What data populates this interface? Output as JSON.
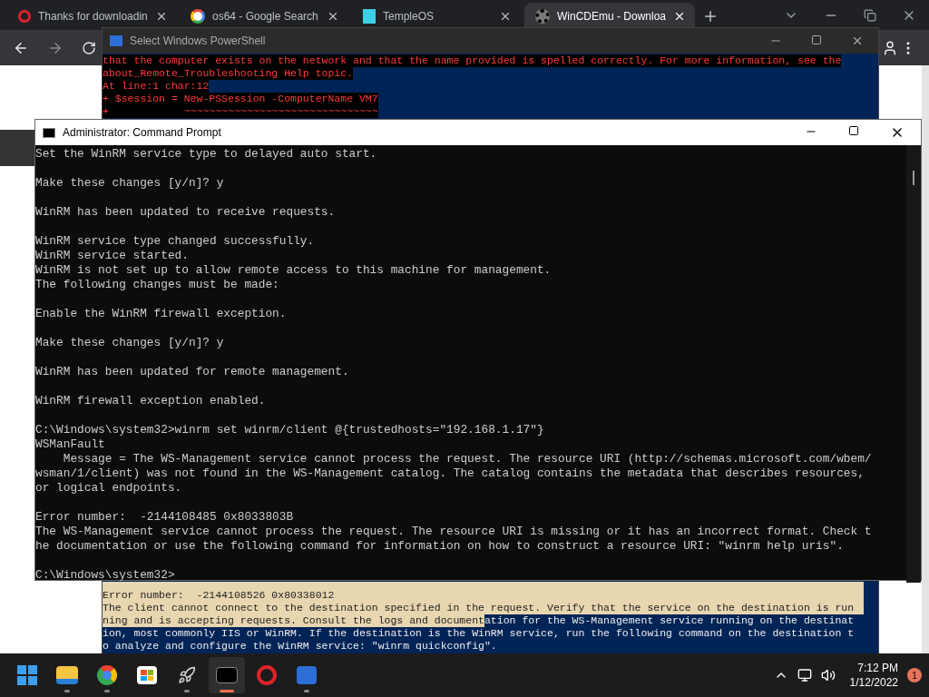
{
  "browser": {
    "tabs": [
      {
        "title": "Thanks for downloadin",
        "kind": "opera",
        "selected": false
      },
      {
        "title": "os64 - Google Search",
        "kind": "google",
        "selected": false
      },
      {
        "title": "TempleOS",
        "kind": "temple",
        "selected": false
      },
      {
        "title": "WinCDEmu - Downloa",
        "kind": "gear",
        "selected": true
      }
    ]
  },
  "powershell": {
    "title": "Select Windows PowerShell",
    "top_lines": [
      "that the computer exists on the network and that the name provided is spelled correctly. For more information, see the",
      "about_Remote_Troubleshooting Help topic.",
      "At line:1 char:12",
      "+ $session = New-PSSession -ComputerName VM7",
      "+            ~~~~~~~~~~~~~~~~~~~~~~~~~~~~~~~"
    ],
    "bottom_lines": [
      [
        {
          "text": "Error number:  -2144108526 0x80338012",
          "selected": true
        }
      ],
      [
        {
          "text": "The client cannot connect to the destination specified in the request. Verify that the service on the destination is run",
          "selected": true
        }
      ],
      [
        {
          "text": "ning and is accepting requests. Consult the logs and document",
          "selected": true
        },
        {
          "text": "ation for the WS-Management service running on the destinat",
          "selected": false
        }
      ],
      [
        {
          "text": "ion, most commonly IIS or WinRM. If the destination is the WinRM service, run the following command on the destination t",
          "selected": false
        }
      ],
      [
        {
          "text": "o analyze and configure the WinRM service: \"winrm quickconfig\".",
          "selected": false
        }
      ]
    ]
  },
  "cmd": {
    "title": "Administrator: Command Prompt",
    "blocks": [
      [
        "Set the WinRM service type to delayed auto start."
      ],
      [
        "Make these changes [y/n]? y"
      ],
      [
        "WinRM has been updated to receive requests."
      ],
      [
        "WinRM service type changed successfully.",
        "WinRM service started.",
        "WinRM is not set up to allow remote access to this machine for management.",
        "The following changes must be made:"
      ],
      [
        "Enable the WinRM firewall exception."
      ],
      [
        "Make these changes [y/n]? y"
      ],
      [
        "WinRM has been updated for remote management."
      ],
      [
        "WinRM firewall exception enabled."
      ],
      [
        "C:\\Windows\\system32>winrm set winrm/client @{trustedhosts=\"192.168.1.17\"}",
        "WSManFault",
        "    Message = The WS-Management service cannot process the request. The resource URI (http://schemas.microsoft.com/wbem/",
        "wsman/1/client) was not found in the WS-Management catalog. The catalog contains the metadata that describes resources,",
        "or logical endpoints."
      ],
      [
        "Error number:  -2144108485 0x8033803B",
        "The WS-Management service cannot process the request. The resource URI is missing or it has an incorrect format. Check t",
        "he documentation or use the following command for information on how to construct a resource URI: \"winrm help uris\"."
      ],
      [
        "C:\\Windows\\system32>"
      ]
    ]
  },
  "taskbar": {
    "apps": [
      {
        "kind": "start",
        "running": false,
        "active": false
      },
      {
        "kind": "explorer",
        "running": true,
        "active": false
      },
      {
        "kind": "chrome",
        "running": true,
        "active": false
      },
      {
        "kind": "store",
        "running": false,
        "active": false
      },
      {
        "kind": "rocket",
        "running": true,
        "active": false
      },
      {
        "kind": "cmd",
        "running": true,
        "active": true
      },
      {
        "kind": "opera",
        "running": false,
        "active": false
      },
      {
        "kind": "powershell",
        "running": true,
        "active": false
      }
    ],
    "time": "7:12 PM",
    "date": "1/12/2022",
    "notifications": "1"
  }
}
